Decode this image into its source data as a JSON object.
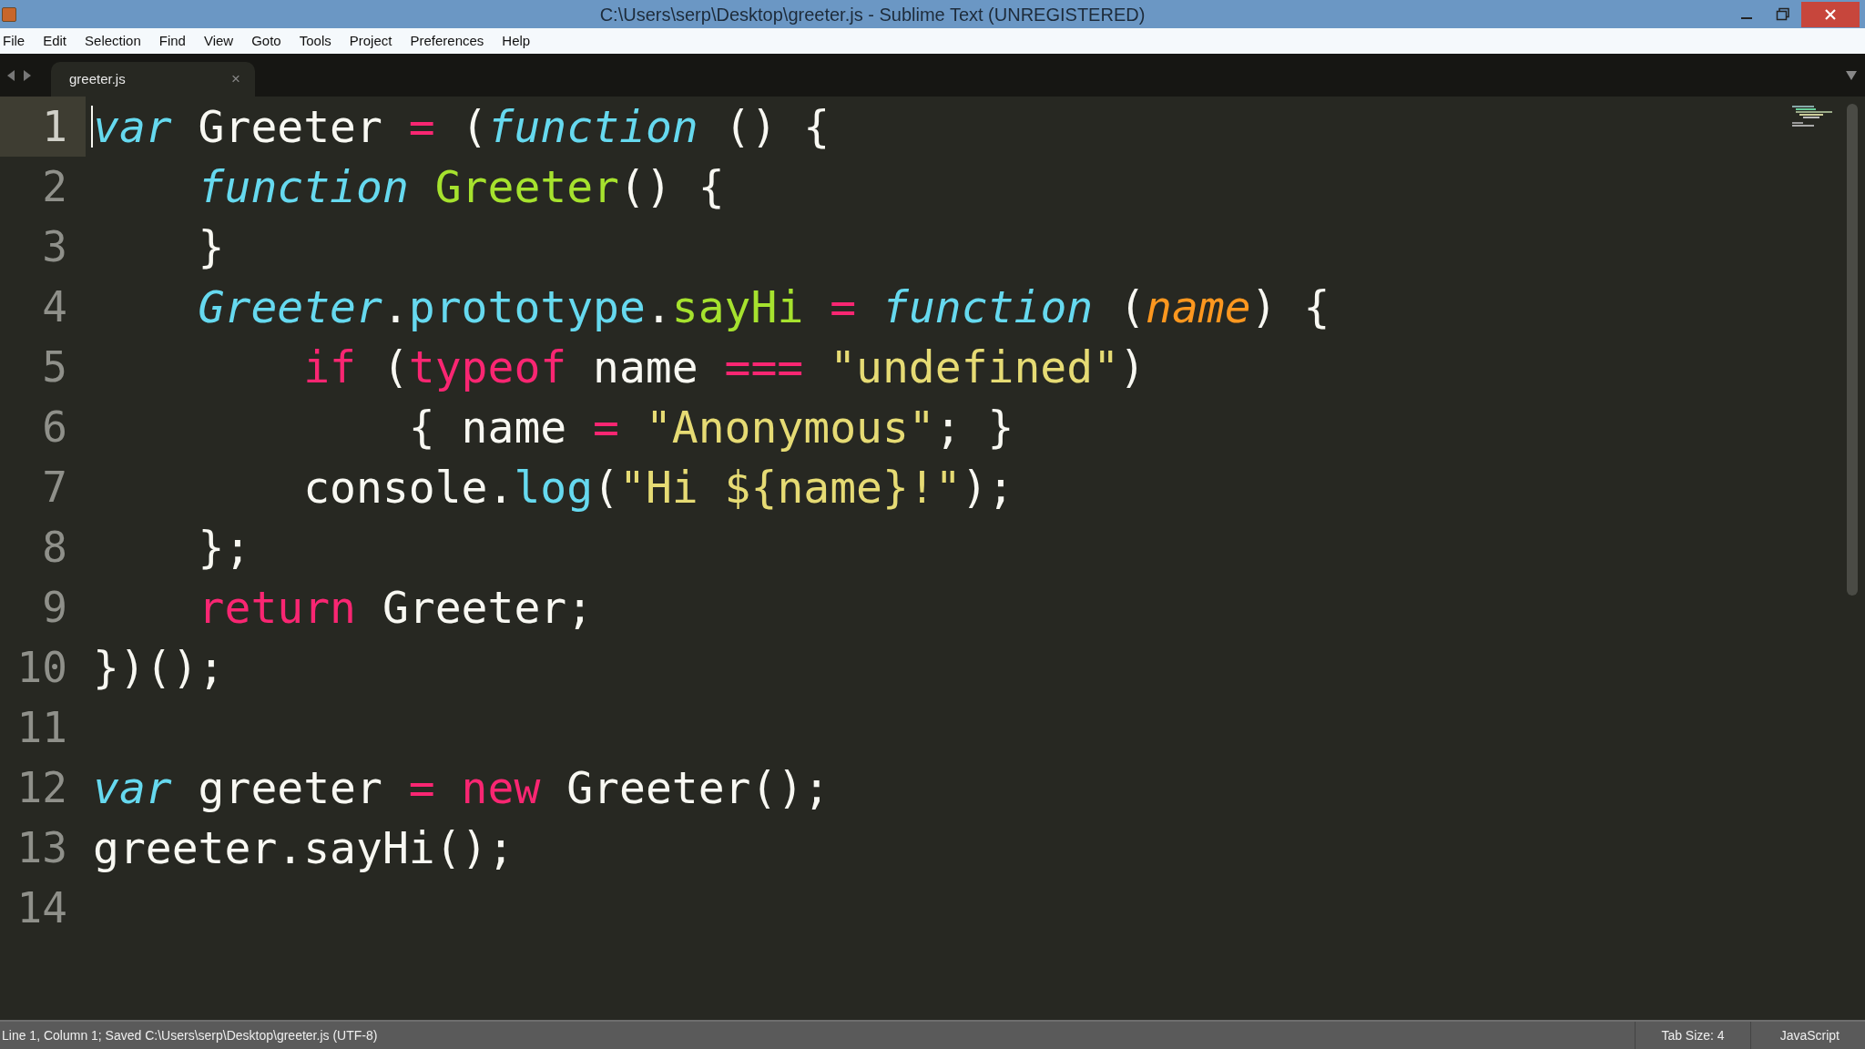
{
  "window": {
    "title": "C:\\Users\\serp\\Desktop\\greeter.js - Sublime Text (UNREGISTERED)"
  },
  "menu": [
    "File",
    "Edit",
    "Selection",
    "Find",
    "View",
    "Goto",
    "Tools",
    "Project",
    "Preferences",
    "Help"
  ],
  "tabs": [
    {
      "label": "greeter.js",
      "selected": true,
      "close": "×"
    }
  ],
  "editor": {
    "lines": [
      {
        "number": "1",
        "current": true,
        "tokens": [
          {
            "text": "var",
            "kind": "storage"
          },
          {
            "text": " Greeter ",
            "kind": "plain"
          },
          {
            "text": "=",
            "kind": "keyword"
          },
          {
            "text": " (",
            "kind": "plain"
          },
          {
            "text": "function",
            "kind": "storage"
          },
          {
            "text": " () {",
            "kind": "plain"
          }
        ]
      },
      {
        "number": "2",
        "current": false,
        "tokens": [
          {
            "text": "    function",
            "kind": "storage"
          },
          {
            "text": " Greeter",
            "kind": "entity"
          },
          {
            "text": "() {",
            "kind": "plain"
          }
        ]
      },
      {
        "number": "3",
        "current": false,
        "tokens": [
          {
            "text": "    }",
            "kind": "plain"
          }
        ]
      },
      {
        "number": "4",
        "current": false,
        "tokens": [
          {
            "text": "    Greeter",
            "kind": "storage"
          },
          {
            "text": ".",
            "kind": "plain"
          },
          {
            "text": "prototype",
            "kind": "support"
          },
          {
            "text": ".",
            "kind": "plain"
          },
          {
            "text": "sayHi",
            "kind": "entity"
          },
          {
            "text": " =",
            "kind": "keyword"
          },
          {
            "text": " function",
            "kind": "storage"
          },
          {
            "text": " (",
            "kind": "plain"
          },
          {
            "text": "name",
            "kind": "param"
          },
          {
            "text": ") {",
            "kind": "plain"
          }
        ]
      },
      {
        "number": "5",
        "current": false,
        "tokens": [
          {
            "text": "        if",
            "kind": "keyword"
          },
          {
            "text": " (",
            "kind": "plain"
          },
          {
            "text": "typeof",
            "kind": "keyword"
          },
          {
            "text": " name ",
            "kind": "plain"
          },
          {
            "text": "===",
            "kind": "keyword"
          },
          {
            "text": " \"undefined\"",
            "kind": "string"
          },
          {
            "text": ")",
            "kind": "plain"
          }
        ]
      },
      {
        "number": "6",
        "current": false,
        "tokens": [
          {
            "text": "            { name ",
            "kind": "plain"
          },
          {
            "text": "=",
            "kind": "keyword"
          },
          {
            "text": " \"Anonymous\"",
            "kind": "string"
          },
          {
            "text": "; }",
            "kind": "plain"
          }
        ]
      },
      {
        "number": "7",
        "current": false,
        "tokens": [
          {
            "text": "        console",
            "kind": "plain"
          },
          {
            "text": ".",
            "kind": "plain"
          },
          {
            "text": "log",
            "kind": "support"
          },
          {
            "text": "(",
            "kind": "plain"
          },
          {
            "text": "\"Hi ${name}!\"",
            "kind": "string"
          },
          {
            "text": ");",
            "kind": "plain"
          }
        ]
      },
      {
        "number": "8",
        "current": false,
        "tokens": [
          {
            "text": "    };",
            "kind": "plain"
          }
        ]
      },
      {
        "number": "9",
        "current": false,
        "tokens": [
          {
            "text": "    return",
            "kind": "keyword"
          },
          {
            "text": " Greeter;",
            "kind": "plain"
          }
        ]
      },
      {
        "number": "10",
        "current": false,
        "tokens": [
          {
            "text": "})();",
            "kind": "plain"
          }
        ]
      },
      {
        "number": "11",
        "current": false
      },
      {
        "number": "12",
        "current": false,
        "tokens": [
          {
            "text": "var",
            "kind": "storage"
          },
          {
            "text": " greeter ",
            "kind": "plain"
          },
          {
            "text": "=",
            "kind": "keyword"
          },
          {
            "text": " new",
            "kind": "keyword"
          },
          {
            "text": " Greeter();",
            "kind": "plain"
          }
        ]
      },
      {
        "number": "13",
        "current": false,
        "tokens": [
          {
            "text": "greeter.sayHi();",
            "kind": "plain"
          }
        ]
      },
      {
        "number": "14",
        "current": false
      }
    ]
  },
  "status_bar": {
    "message": "Line 1, Column 1; Saved C:\\Users\\serp\\Desktop\\greeter.js (UTF-8)",
    "tab_size": "Tab Size: 4",
    "syntax": "JavaScript"
  }
}
